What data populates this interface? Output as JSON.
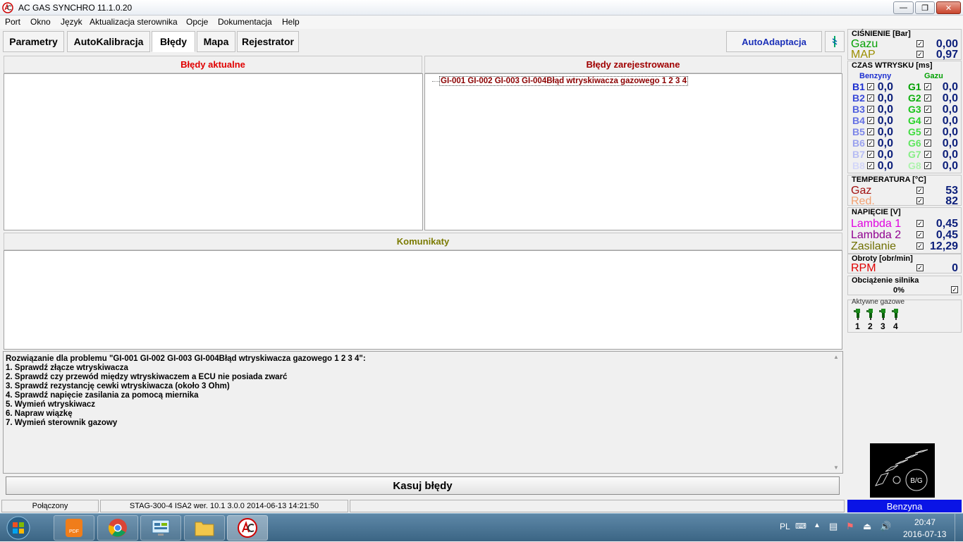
{
  "window": {
    "title": "AC GAS SYNCHRO  11.1.0.20",
    "minimize": "—",
    "maximize": "❐",
    "close": "✕"
  },
  "menu": [
    "Port",
    "Okno",
    "Język",
    "Aktualizacja sterownika",
    "Opcje",
    "Dokumentacja",
    "Help"
  ],
  "tabs": [
    "Parametry",
    "AutoKalibracja",
    "Błędy",
    "Mapa",
    "Rejestrator"
  ],
  "active_tab": "Błędy",
  "autoadaptacja_label": "AutoAdaptacja",
  "errors_current": {
    "title": "Błędy aktualne"
  },
  "errors_registered": {
    "title": "Błędy zarejestrowane",
    "items": [
      "GI-001 GI-002 GI-003 GI-004Błąd wtryskiwacza gazowego 1 2 3 4"
    ]
  },
  "messages": {
    "title": "Komunikaty"
  },
  "solution": {
    "header": "Rozwiązanie dla problemu \"GI-001 GI-002 GI-003 GI-004Błąd wtryskiwacza gazowego 1 2 3 4\":",
    "steps": [
      "1. Sprawdź złącze wtryskiwacza",
      "2. Sprawdź czy przewód między wtryskiwaczem a ECU nie posiada zwarć",
      "3. Sprawdź rezystancję cewki wtryskiwacza (około 3 Ohm)",
      "4. Sprawdź napięcie zasilania za pomocą miernika",
      "5. Wymień wtryskiwacz",
      "6. Napraw wiązkę",
      "7. Wymień sterownik gazowy"
    ]
  },
  "clear_errors_label": "Kasuj błędy",
  "sidebar": {
    "pressure": {
      "title": "CIŚNIENIE [Bar]",
      "gas_label": "Gazu",
      "gas": "0,00",
      "map_label": "MAP",
      "map": "0,97"
    },
    "injection": {
      "title": "CZAS WTRYSKU  [ms]",
      "petrol_header": "Benzyny",
      "gas_header": "Gazu",
      "petrol": [
        {
          "label": "B1",
          "value": "0,0"
        },
        {
          "label": "B2",
          "value": "0,0"
        },
        {
          "label": "B3",
          "value": "0,0"
        },
        {
          "label": "B4",
          "value": "0,0"
        },
        {
          "label": "B5",
          "value": "0,0"
        },
        {
          "label": "B6",
          "value": "0,0"
        },
        {
          "label": "B7",
          "value": "0,0"
        },
        {
          "label": "B8",
          "value": "0,0"
        }
      ],
      "gas": [
        {
          "label": "G1",
          "value": "0,0"
        },
        {
          "label": "G2",
          "value": "0,0"
        },
        {
          "label": "G3",
          "value": "0,0"
        },
        {
          "label": "G4",
          "value": "0,0"
        },
        {
          "label": "G5",
          "value": "0,0"
        },
        {
          "label": "G6",
          "value": "0,0"
        },
        {
          "label": "G7",
          "value": "0,0"
        },
        {
          "label": "G8",
          "value": "0,0"
        }
      ]
    },
    "temperature": {
      "title": "TEMPERATURA  [°C]",
      "gas_label": "Gaz",
      "gas": "53",
      "red_label": "Red.",
      "red": "82"
    },
    "voltage": {
      "title": "NAPIĘCIE [V]",
      "l1_label": "Lambda 1",
      "l1": "0,45",
      "l2_label": "Lambda 2",
      "l2": "0,45",
      "sup_label": "Zasilanie",
      "sup": "12,29"
    },
    "rpm": {
      "title": "Obroty [obr/min]",
      "label": "RPM",
      "value": "0"
    },
    "load": {
      "title": "Obciążenie silnika",
      "value": "0%"
    },
    "active_gas": {
      "title": "Aktywne gazowe",
      "injectors": [
        "1",
        "2",
        "3",
        "4"
      ]
    },
    "switch_label": "B/G",
    "fuel_mode": "Benzyna"
  },
  "status": {
    "connection": "Połączony",
    "device": "STAG-300-4 ISA2  wer. 10.1  3.0.0   2014-06-13 14:21:50"
  },
  "taskbar": {
    "lang": "PL",
    "time": "20:47",
    "date": "2016-07-13",
    "pdf_label": "PDF"
  },
  "colors": {
    "b1": "#1c2fd0",
    "b2": "#3a4ad8",
    "b3": "#4f5ede",
    "b4": "#6470e4",
    "b5": "#7c86e8",
    "b6": "#9aa2ee",
    "b7": "#b7bdf3",
    "b8": "#d4d7f8",
    "g1": "#00a000",
    "g2": "#10b010",
    "g3": "#18c418",
    "g4": "#28d428",
    "g5": "#40dd40",
    "g6": "#60e660",
    "g7": "#86ee86",
    "g8": "#aef3ae"
  }
}
